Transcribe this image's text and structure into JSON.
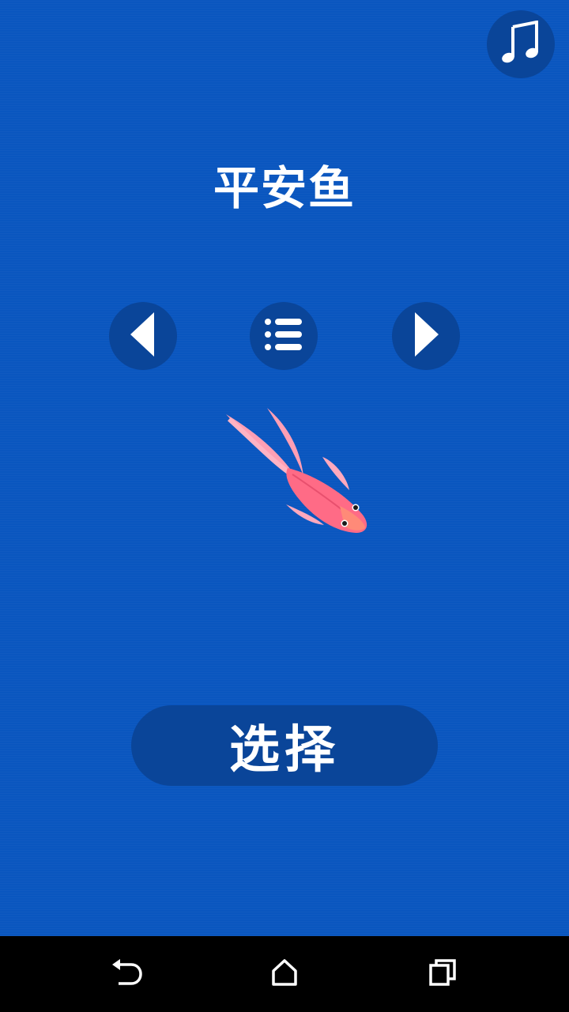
{
  "game": {
    "title": "平安鱼",
    "select_label": "选择",
    "selected_fish": "pink-fish"
  },
  "icons": {
    "music": "music-note-icon",
    "prev": "triangle-left-icon",
    "list": "list-icon",
    "next": "triangle-right-icon"
  },
  "colors": {
    "background": "#0a56bf",
    "button": "#0a4599",
    "fish_body": "#ff6b86",
    "fish_fin": "#ff9fb4"
  },
  "navbar": {
    "back": "back-icon",
    "home": "home-icon",
    "recent": "recent-apps-icon"
  }
}
